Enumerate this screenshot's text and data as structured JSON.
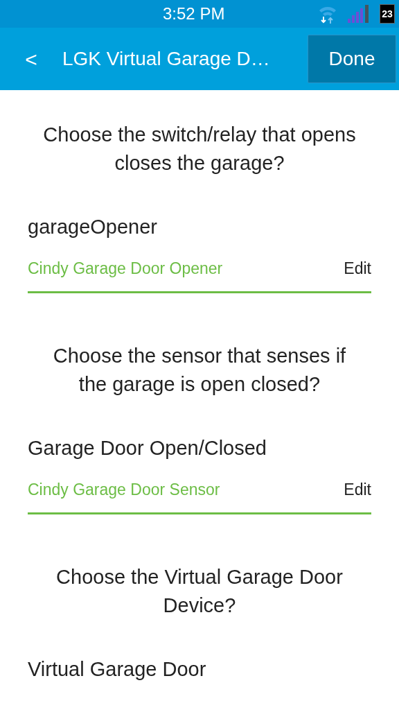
{
  "status_bar": {
    "time": "3:52 PM",
    "battery": "23"
  },
  "header": {
    "back": "<",
    "title": "LGK Virtual Garage D…",
    "done": "Done"
  },
  "sections": [
    {
      "question": "Choose the switch/relay that opens closes the garage?",
      "label": "garageOpener",
      "value": "Cindy Garage Door Opener",
      "edit": "Edit"
    },
    {
      "question": "Choose the sensor that senses if the garage is open closed?",
      "label": "Garage Door Open/Closed",
      "value": "Cindy Garage Door Sensor",
      "edit": "Edit"
    },
    {
      "question": "Choose the Virtual Garage Door Device?",
      "label": "Virtual Garage Door"
    }
  ]
}
